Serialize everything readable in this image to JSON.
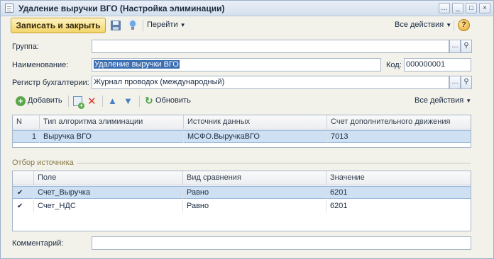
{
  "window": {
    "title": "Удаление выручки ВГО (Настройка элиминации)",
    "controls": [
      "…",
      "_",
      "□",
      "×"
    ]
  },
  "toolbar": {
    "save_close_label": "Записать и закрыть",
    "goto_label": "Перейти",
    "all_actions_label": "Все действия",
    "help_label": "?"
  },
  "form": {
    "group_label": "Группа:",
    "group_value": "",
    "name_label": "Наименование:",
    "name_value": "Удаление выручки ВГО",
    "code_label": "Код:",
    "code_value": "000000001",
    "register_label": "Регистр бухгалтерии:",
    "register_value": "Журнал проводок (международный)",
    "comment_label": "Комментарий:",
    "comment_value": ""
  },
  "table_toolbar": {
    "add_label": "Добавить",
    "refresh_label": "Обновить",
    "all_actions_label": "Все действия"
  },
  "algorithms_table": {
    "columns": [
      "N",
      "Тип алгоритма элиминации",
      "Источник данных",
      "Счет дополнительного движения"
    ],
    "rows": [
      [
        "1",
        "Выручка ВГО",
        "МСФО.ВыручкаВГО",
        "7013"
      ]
    ]
  },
  "source_filter": {
    "section_label": "Отбор источника",
    "columns": [
      "Поле",
      "Вид сравнения",
      "Значение"
    ],
    "rows": [
      {
        "checked": true,
        "field": "Счет_Выручка",
        "comparison": "Равно",
        "value": "6201"
      },
      {
        "checked": true,
        "field": "Счет_НДС",
        "comparison": "Равно",
        "value": "6201"
      }
    ]
  }
}
